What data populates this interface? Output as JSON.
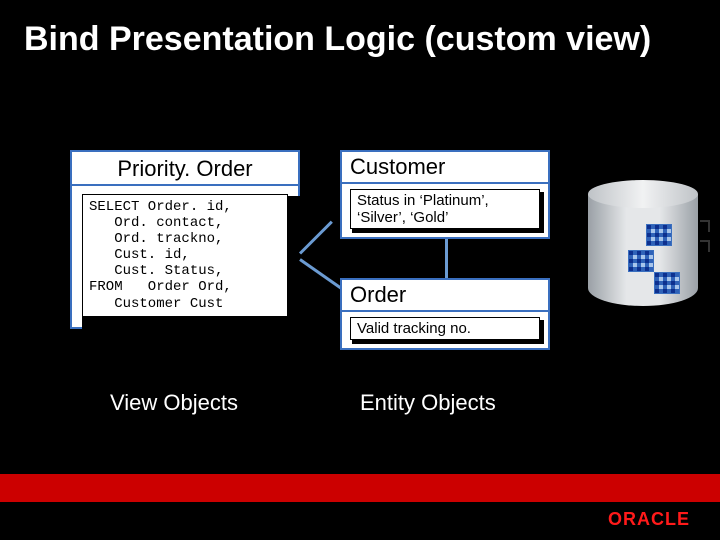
{
  "slide": {
    "title": "Bind Presentation Logic (custom view)"
  },
  "view_object": {
    "name": "Priority. Order",
    "sql": "SELECT Order. id,\n   Ord. contact,\n   Ord. trackno,\n   Cust. id,\n   Cust. Status,\nFROM   Order Ord,\n   Customer Cust"
  },
  "entities": {
    "customer": {
      "name": "Customer",
      "rule": "Status in ‘Platinum’, ‘Silver’, ‘Gold’"
    },
    "order": {
      "name": "Order",
      "rule": "Valid tracking no."
    }
  },
  "labels": {
    "view_objects": "View Objects",
    "entity_objects": "Entity Objects"
  },
  "branding": {
    "logo_text": "ORACLE",
    "accent_color": "#cc0000"
  }
}
